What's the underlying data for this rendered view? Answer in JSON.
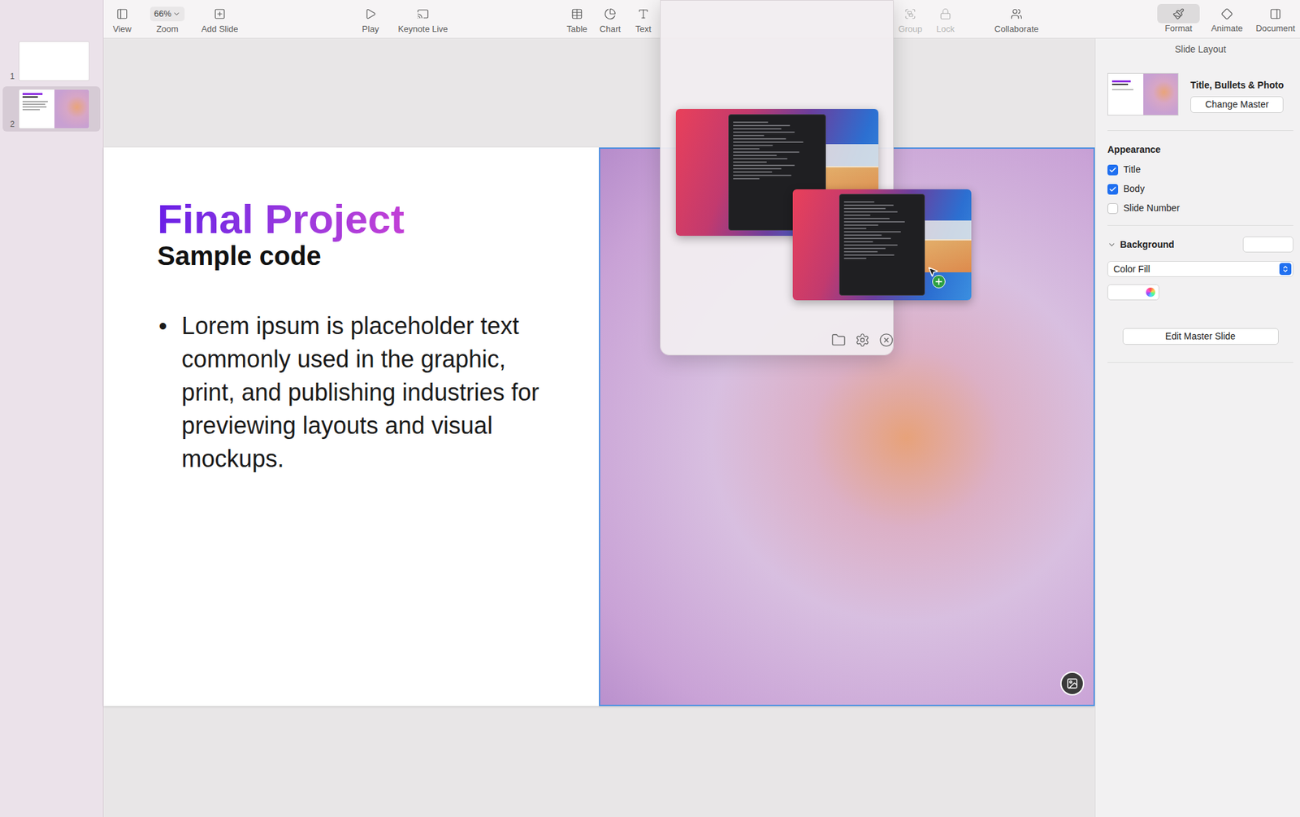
{
  "toolbar": {
    "groups": [
      [
        {
          "label": "View",
          "disabled": false
        },
        {
          "label": "Zoom",
          "disabled": false,
          "value": "66%"
        },
        {
          "label": "Add Slide",
          "disabled": false
        }
      ],
      [
        {
          "label": "Play",
          "disabled": false
        },
        {
          "label": "Keynote Live",
          "disabled": false
        }
      ],
      [
        {
          "label": "Table",
          "disabled": false
        },
        {
          "label": "Chart",
          "disabled": false
        },
        {
          "label": "Text",
          "disabled": false
        }
      ],
      [
        {
          "label": "Group",
          "disabled": true
        },
        {
          "label": "Lock",
          "disabled": true
        }
      ],
      [
        {
          "label": "Collaborate",
          "disabled": false
        }
      ]
    ],
    "inspector_tabs": [
      {
        "label": "Format",
        "selected": true
      },
      {
        "label": "Animate",
        "selected": false
      },
      {
        "label": "Document",
        "selected": false
      }
    ]
  },
  "slides": [
    {
      "number": "1",
      "selected": false,
      "kind": "blank"
    },
    {
      "number": "2",
      "selected": true,
      "kind": "photo"
    }
  ],
  "slide": {
    "title": "Final Project",
    "subtitle": "Sample code",
    "bullets": [
      "Lorem ipsum is placeholder text commonly used in the graphic, print, and publishing industries for previewing layouts and visual mockups."
    ],
    "photo_selected": true
  },
  "inspector": {
    "header": "Slide Layout",
    "layout_name": "Title, Bullets & Photo",
    "change_master": "Change Master",
    "appearance": {
      "label": "Appearance",
      "options": [
        {
          "label": "Title",
          "checked": true
        },
        {
          "label": "Body",
          "checked": true
        },
        {
          "label": "Slide Number",
          "checked": false
        }
      ]
    },
    "background": {
      "label": "Background",
      "expanded": true,
      "fill": "Color Fill"
    },
    "edit_master": "Edit Master Slide"
  },
  "screenshot_popover": {
    "thumbnails": [
      {
        "kind": "window"
      },
      {
        "kind": "dragging"
      }
    ]
  }
}
